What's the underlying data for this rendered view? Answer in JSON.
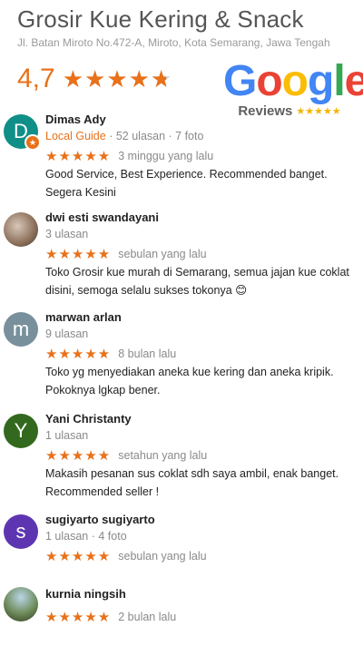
{
  "business": {
    "name": "Grosir Kue Kering & Snack",
    "address": "Jl. Batan Miroto No.472-A, Miroto, Kota Semarang, Jawa Tengah",
    "rating": "4,7",
    "rating_value": 4.7
  },
  "badge": {
    "google_letters": [
      "G",
      "o",
      "o",
      "g",
      "l",
      "e"
    ],
    "reviews_label": "Reviews",
    "stars": "★★★★★"
  },
  "reviews": [
    {
      "name": "Dimas Ady",
      "initial": "D",
      "avatar_color": "#0f8f88",
      "local_guide": "Local Guide",
      "meta": "· 52 ulasan · 7 foto",
      "stars": "★★★★★",
      "when": "3 minggu yang lalu",
      "text": "Good Service, Best Experience. Recommended banget. Segera Kesini"
    },
    {
      "name": "dwi esti swandayani",
      "initial": "",
      "avatar_color": "",
      "meta": "3 ulasan",
      "stars": "★★★★★",
      "when": "sebulan yang lalu",
      "text": "Toko Grosir kue murah di Semarang, semua jajan kue coklat disini, semoga selalu sukses tokonya 😊"
    },
    {
      "name": "marwan arlan",
      "initial": "m",
      "avatar_color": "#78909c",
      "meta": "9 ulasan",
      "stars": "★★★★★",
      "when": "8 bulan lalu",
      "text": "Toko yg menyediakan aneka kue kering dan aneka kripik. Pokoknya lgkap bener."
    },
    {
      "name": "Yani Christanty",
      "initial": "Y",
      "avatar_color": "#33691e",
      "meta": "1 ulasan",
      "stars": "★★★★★",
      "when": "setahun yang lalu",
      "text": "Makasih pesanan sus coklat sdh saya ambil, enak banget. Recommended seller !"
    },
    {
      "name": "sugiyarto sugiyarto",
      "initial": "s",
      "avatar_color": "#5e35b1",
      "meta": "1 ulasan · 4 foto",
      "stars": "★★★★★",
      "when": "sebulan yang lalu",
      "text": ""
    },
    {
      "name": "kurnia ningsih",
      "initial": "",
      "avatar_color": "",
      "meta": "",
      "stars": "★★★★★",
      "when": "2 bulan lalu",
      "text": ""
    }
  ]
}
